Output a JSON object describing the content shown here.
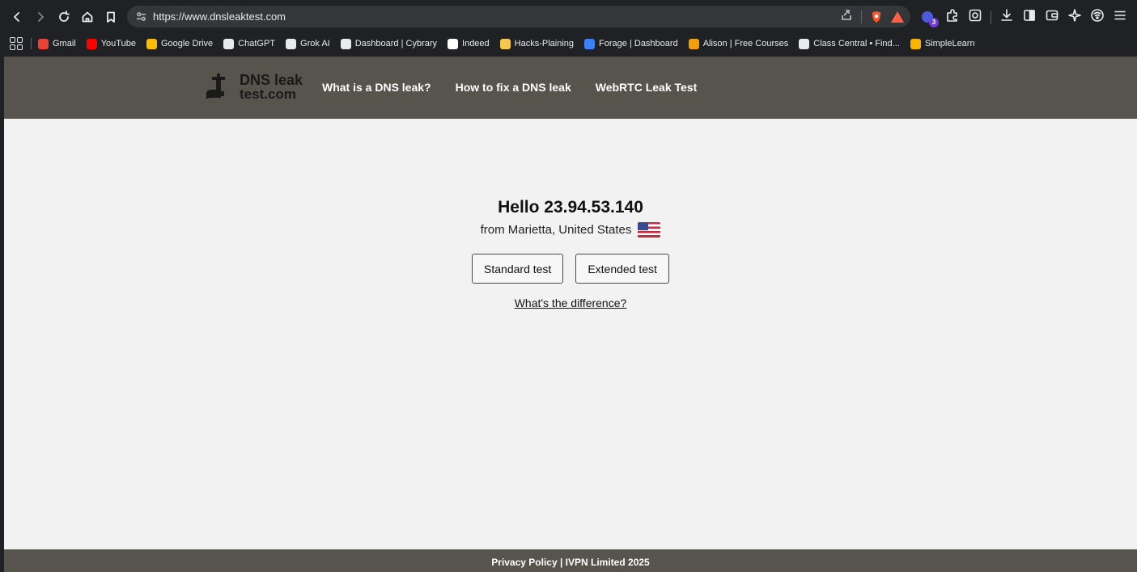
{
  "browser": {
    "url": "https://www.dnsleaktest.com",
    "extension_badge_count": "3",
    "bookmarks": [
      {
        "label": "Gmail",
        "icon": "gmail-icon",
        "color": "#ea4335"
      },
      {
        "label": "YouTube",
        "icon": "youtube-icon",
        "color": "#ff0000"
      },
      {
        "label": "Google Drive",
        "icon": "google-drive-icon",
        "color": "#fbbc04"
      },
      {
        "label": "ChatGPT",
        "icon": "chatgpt-icon",
        "color": "#e8eaed"
      },
      {
        "label": "Grok AI",
        "icon": "grok-icon",
        "color": "#e8eaed"
      },
      {
        "label": "Dashboard | Cybrary",
        "icon": "cybrary-icon",
        "color": "#e8eaed"
      },
      {
        "label": "Indeed",
        "icon": "indeed-icon",
        "color": "#ffffff"
      },
      {
        "label": "Hacks-Plaining",
        "icon": "hacksplaining-icon",
        "color": "#f2c94c"
      },
      {
        "label": "Forage | Dashboard",
        "icon": "forage-icon",
        "color": "#3b82f6"
      },
      {
        "label": "Alison | Free Courses",
        "icon": "alison-icon",
        "color": "#f59e0b"
      },
      {
        "label": "Class Central • Find...",
        "icon": "class-central-icon",
        "color": "#e8eaed"
      },
      {
        "label": "SimpleLearn",
        "icon": "simplilearn-icon",
        "color": "#f7b500"
      }
    ]
  },
  "site": {
    "logo": {
      "line1": "DNS leak",
      "line2": "test.com"
    },
    "nav": [
      "What is a DNS leak?",
      "How to fix a DNS leak",
      "WebRTC Leak Test"
    ],
    "greeting": "Hello 23.94.53.140",
    "location": "from Marietta, United States",
    "buttons": {
      "standard": "Standard test",
      "extended": "Extended test"
    },
    "difference_link": "What's the difference?",
    "footer": "Privacy Policy | IVPN Limited 2025"
  },
  "colors": {
    "header_bg": "#57534d",
    "page_bg": "#f2f2f2",
    "chrome_bg": "#202124"
  }
}
